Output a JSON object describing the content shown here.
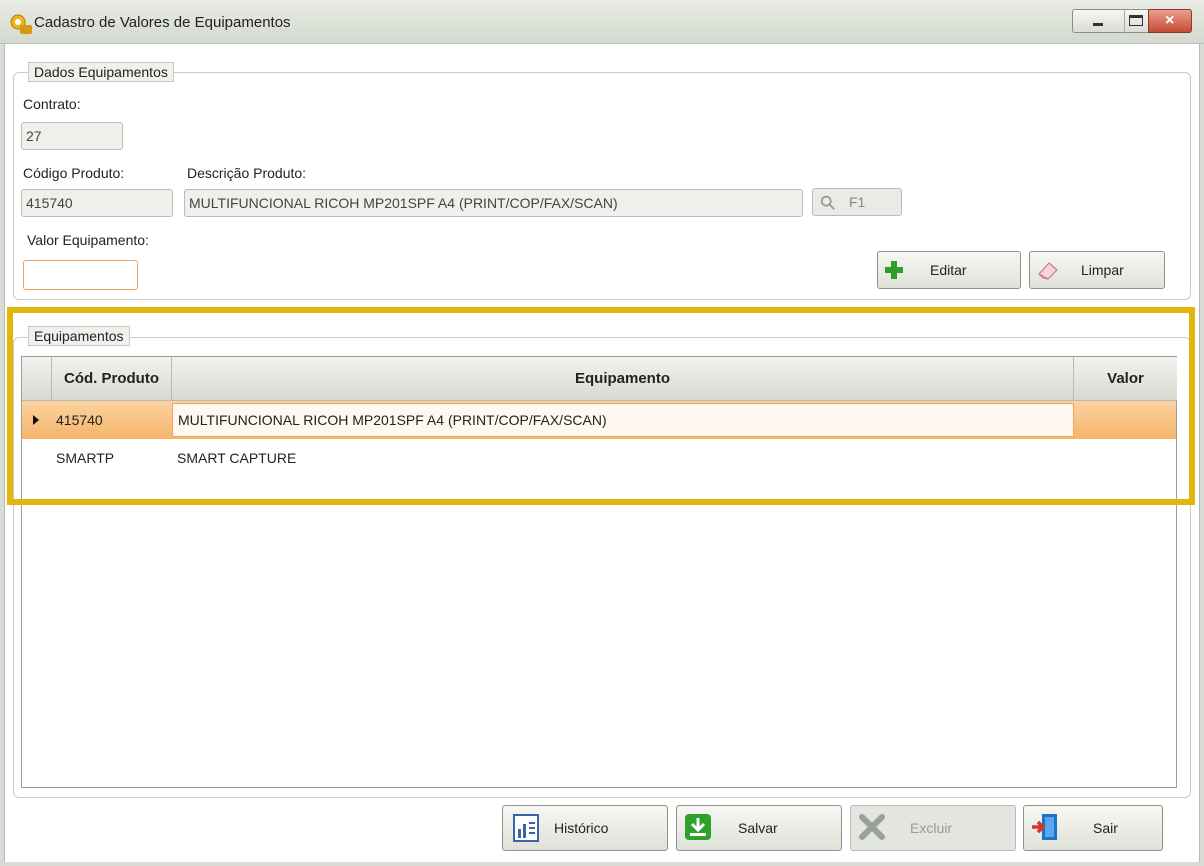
{
  "window": {
    "title": "Cadastro de Valores de Equipamentos",
    "accent": "#e2b60d"
  },
  "dados": {
    "legend": "Dados Equipamentos",
    "contrato_label": "Contrato:",
    "contrato_value": "27",
    "codigo_label": "Código Produto:",
    "codigo_value": "415740",
    "descricao_label": "Descrição Produto:",
    "descricao_value": "MULTIFUNCIONAL RICOH MP201SPF A4 (PRINT/COP/FAX/SCAN)",
    "search_label": "F1",
    "valor_label": "Valor Equipamento:",
    "valor_value": "",
    "editar_label": "Editar",
    "limpar_label": "Limpar"
  },
  "equipamentos": {
    "legend": "Equipamentos",
    "columns": [
      "Cód. Produto",
      "Equipamento",
      "Valor"
    ],
    "rows": [
      {
        "codigo": "415740",
        "equipamento": "MULTIFUNCIONAL RICOH MP201SPF A4 (PRINT/COP/FAX/SCAN)",
        "valor": ""
      },
      {
        "codigo": "SMARTP",
        "equipamento": "SMART CAPTURE",
        "valor": ""
      }
    ]
  },
  "footer": {
    "historico_label": "Histórico",
    "salvar_label": "Salvar",
    "excluir_label": "Excluir",
    "sair_label": "Sair"
  }
}
